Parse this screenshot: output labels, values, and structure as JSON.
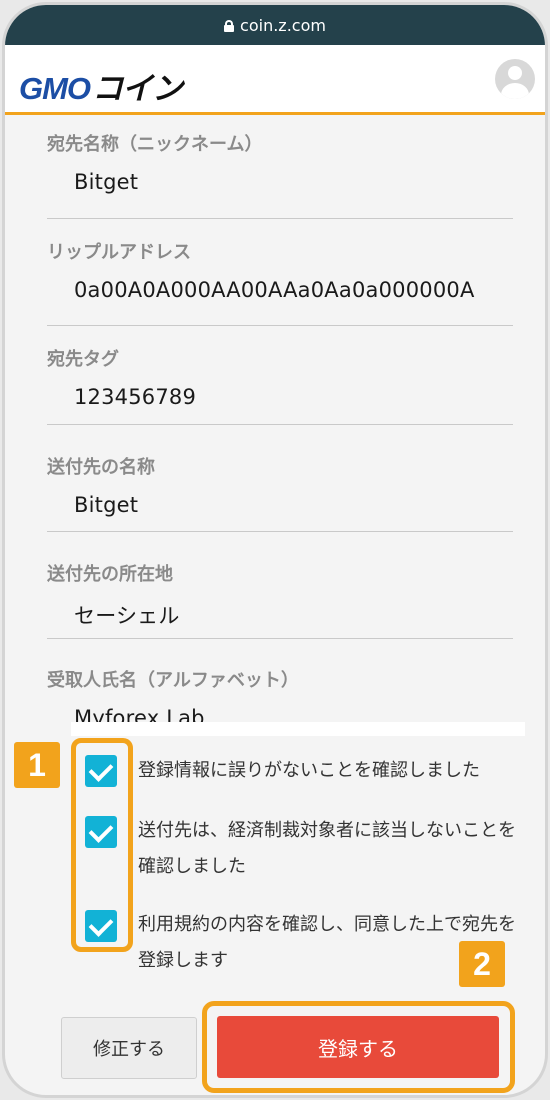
{
  "browser": {
    "url": "coin.z.com"
  },
  "header": {
    "logo_gmo": "GMO",
    "logo_coin": "コイン"
  },
  "fields": [
    {
      "label": "宛先名称（ニックネーム）",
      "value": "Bitget"
    },
    {
      "label": "リップルアドレス",
      "value": "0a00A0A000AA00AAa0Aa0a000000A"
    },
    {
      "label": "宛先タグ",
      "value": "123456789"
    },
    {
      "label": "送付先の名称",
      "value": "Bitget"
    },
    {
      "label": "送付先の所在地",
      "value": "セーシェル"
    },
    {
      "label": "受取人氏名（アルファベット）",
      "value": "Myforex Lab"
    }
  ],
  "confirmations": [
    {
      "text": "登録情報に誤りがないことを確認しました",
      "checked": true
    },
    {
      "text": "送付先は、経済制裁対象者に該当しないことを確認しました",
      "checked": true
    },
    {
      "text": "利用規約の内容を確認し、同意した上で宛先を登録します",
      "checked": true
    }
  ],
  "badges": {
    "one": "1",
    "two": "2"
  },
  "buttons": {
    "fix": "修正する",
    "register": "登録する"
  },
  "colors": {
    "accent": "#f2a31c",
    "register": "#e84a3a",
    "checkbox": "#12b2d6",
    "urlbar": "#24414b",
    "brand": "#1c4ea5"
  }
}
